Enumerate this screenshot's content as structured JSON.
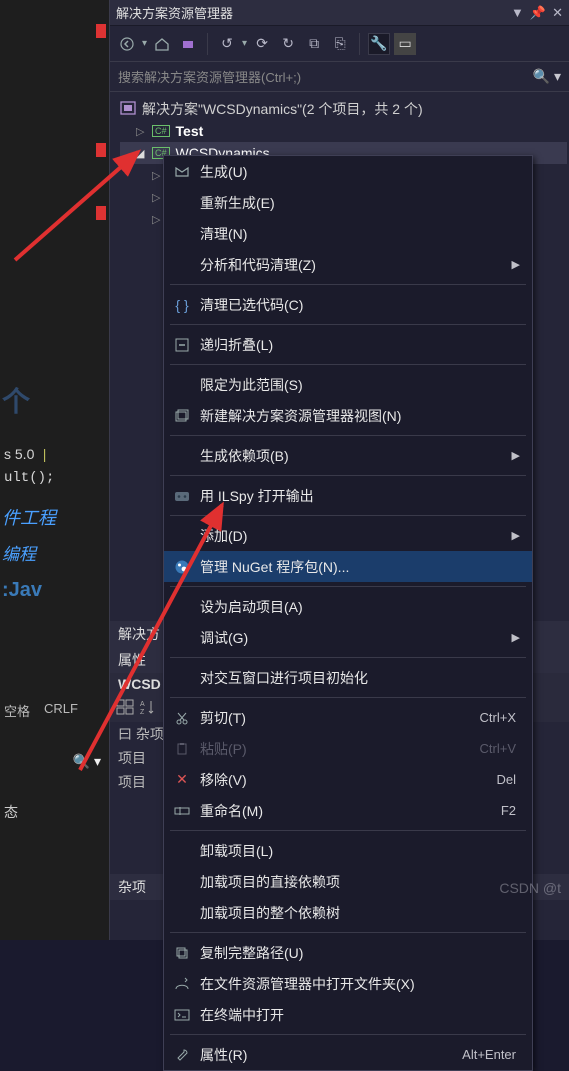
{
  "panel": {
    "title": "解决方案资源管理器",
    "search_placeholder": "搜索解决方案资源管理器(Ctrl+;)"
  },
  "tree": {
    "solution": "解决方案\"WCSDynamics\"(2 个项目，共 2 个)",
    "project1": "Test",
    "project2": "WCSDynamics"
  },
  "menu": {
    "build": "生成(U)",
    "rebuild": "重新生成(E)",
    "clean": "清理(N)",
    "analyze": "分析和代码清理(Z)",
    "clean_selected": "清理已选代码(C)",
    "collapse": "递归折叠(L)",
    "scope": "限定为此范围(S)",
    "new_view": "新建解决方案资源管理器视图(N)",
    "build_deps": "生成依赖项(B)",
    "ilspy": "用 ILSpy 打开输出",
    "add": "添加(D)",
    "nuget": "管理 NuGet 程序包(N)...",
    "startup": "设为启动项目(A)",
    "debug": "调试(G)",
    "interactive": "对交互窗口进行项目初始化",
    "cut": "剪切(T)",
    "paste": "粘贴(P)",
    "remove": "移除(V)",
    "rename": "重命名(M)",
    "unload": "卸载项目(L)",
    "load_direct": "加载项目的直接依赖项",
    "load_tree": "加载项目的整个依赖树",
    "copy_path": "复制完整路径(U)",
    "open_folder": "在文件资源管理器中打开文件夹(X)",
    "open_terminal": "在终端中打开",
    "properties": "属性(R)",
    "sc_cut": "Ctrl+X",
    "sc_paste": "Ctrl+V",
    "sc_remove": "Del",
    "sc_rename": "F2",
    "sc_props": "Alt+Enter"
  },
  "props": {
    "header": "解决方",
    "panel_label": "属性",
    "subject": "WCSD",
    "row1_label": "曰 杂项",
    "row2_label": "项目",
    "row3_label": "项目",
    "misc_label": "杂项"
  },
  "left": {
    "code1": "s 5.0",
    "code2": "ult();",
    "txt1": "件工程",
    "txt2": "编程",
    "txt3": ":Jav",
    "status1": "空格",
    "status2": "CRLF",
    "state": "态"
  },
  "watermark": "CSDN @t"
}
